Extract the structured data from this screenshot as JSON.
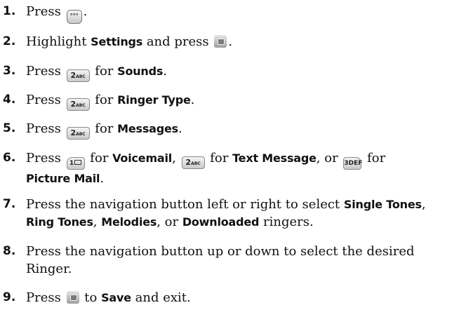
{
  "steps": [
    {
      "num": "1.",
      "t1": "Press ",
      "t2": "."
    },
    {
      "num": "2.",
      "t1": "Highlight ",
      "b1": "Settings",
      "t2": " and press ",
      "t3": "."
    },
    {
      "num": "3.",
      "t1": "Press ",
      "t2": " for ",
      "b1": "Sounds",
      "t3": "."
    },
    {
      "num": "4.",
      "t1": "Press ",
      "t2": " for ",
      "b1": "Ringer Type",
      "t3": "."
    },
    {
      "num": "5.",
      "t1": "Press ",
      "t2": " for ",
      "b1": "Messages",
      "t3": "."
    },
    {
      "num": "6.",
      "t1": "Press ",
      "t2": " for ",
      "b1": "Voicemail",
      "t3": ", ",
      "t4": " for ",
      "b2": "Text Message",
      "t5": ", or ",
      "t6": " for",
      "b3": "Picture Mail",
      "t7": "."
    },
    {
      "num": "7.",
      "t1": "Press the navigation button left or right to select ",
      "b1": "Single Tones",
      "t2": ",",
      "b2": "Ring Tones",
      "t3": ", ",
      "b3": "Melodies",
      "t4": ", or ",
      "b4": "Downloaded",
      "t5": " ringers."
    },
    {
      "num": "8.",
      "t1": "Press the navigation button up or down to select the desired",
      "t2": "Ringer."
    },
    {
      "num": "9.",
      "t1": "Press ",
      "t2": " to ",
      "b1": "Save",
      "t3": " and exit."
    }
  ],
  "keys": {
    "menu": {
      "icon": "menu-key-icon",
      "label": "°°°"
    },
    "ok": {
      "icon": "ok-key-icon",
      "label": ""
    },
    "two": {
      "icon": "key-2abc-icon",
      "big": "2",
      "small": "ABC"
    },
    "one": {
      "icon": "key-1-voicemail-icon",
      "big": "1"
    },
    "three": {
      "icon": "key-3def-icon",
      "big": "3",
      "small": "DEF"
    }
  }
}
